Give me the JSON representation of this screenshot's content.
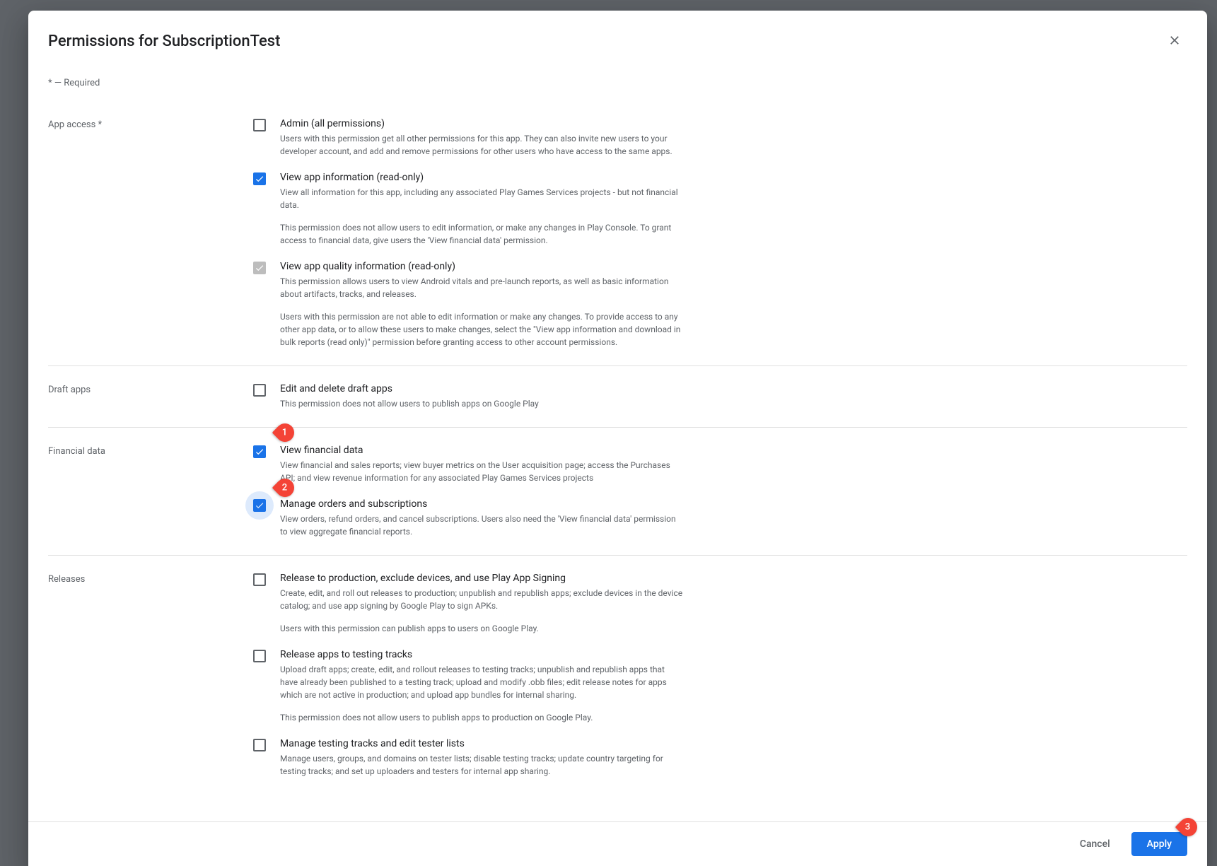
{
  "dialog": {
    "title": "Permissions for SubscriptionTest",
    "required_note": "* — Required"
  },
  "sections": {
    "app_access": {
      "label": "App access  *",
      "items": [
        {
          "title": "Admin (all permissions)",
          "desc1": "Users with this permission get all other permissions for this app. They can also invite new users to your developer account, and add and remove permissions for other users who have access to the same apps."
        },
        {
          "title": "View app information (read-only)",
          "desc1": "View all information for this app, including any associated Play Games Services projects - but not financial data.",
          "desc2": "This permission does not allow users to edit information, or make any changes in Play Console. To grant access to financial data, give users the 'View financial data' permission."
        },
        {
          "title": "View app quality information (read-only)",
          "desc1": "This permission allows users to view Android vitals and pre-launch reports, as well as basic information about artifacts, tracks, and releases.",
          "desc2": "Users with this permission are not able to edit information or make any changes. To provide access to any other app data, or to allow these users to make changes, select the \"View app information and download in bulk reports (read only)\" permission before granting access to other account permissions."
        }
      ]
    },
    "draft_apps": {
      "label": "Draft apps",
      "items": [
        {
          "title": "Edit and delete draft apps",
          "desc1": "This permission does not allow users to publish apps on Google Play"
        }
      ]
    },
    "financial_data": {
      "label": "Financial data",
      "items": [
        {
          "title": "View financial data",
          "desc1": "View financial and sales reports; view buyer metrics on the User acquisition page; access the Purchases API; and view revenue information for any associated Play Games Services projects"
        },
        {
          "title": "Manage orders and subscriptions",
          "desc1": "View orders, refund orders, and cancel subscriptions. Users also need the 'View financial data' permission to view aggregate financial reports."
        }
      ]
    },
    "releases": {
      "label": "Releases",
      "items": [
        {
          "title": "Release to production, exclude devices, and use Play App Signing",
          "desc1": "Create, edit, and roll out releases to production; unpublish and republish apps; exclude devices in the device catalog; and use app signing by Google Play to sign APKs.",
          "desc2": "Users with this permission can publish apps to users on Google Play."
        },
        {
          "title": "Release apps to testing tracks",
          "desc1": "Upload draft apps; create, edit, and rollout releases to testing tracks; unpublish and republish apps that have already been published to a testing track; upload and modify .obb files; edit release notes for apps which are not active in production; and upload app bundles for internal sharing.",
          "desc2": "This permission does not allow users to publish apps to production on Google Play."
        },
        {
          "title": "Manage testing tracks and edit tester lists",
          "desc1": "Manage users, groups, and domains on tester lists; disable testing tracks; update country targeting for testing tracks; and set up uploaders and testers for internal app sharing."
        }
      ]
    }
  },
  "footer": {
    "cancel": "Cancel",
    "apply": "Apply"
  },
  "annotations": {
    "a1": "1",
    "a2": "2",
    "a3": "3"
  }
}
